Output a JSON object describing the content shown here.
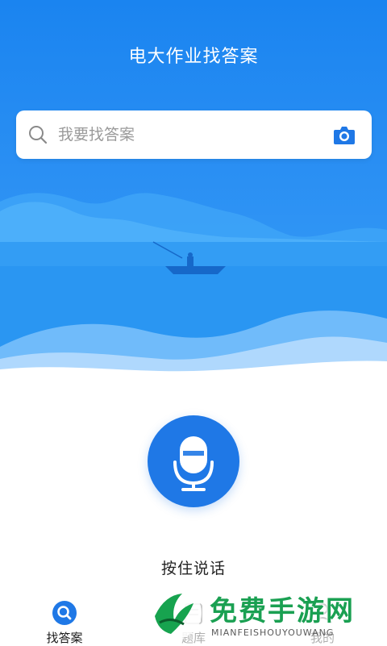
{
  "header": {
    "title": "电大作业找答案"
  },
  "search": {
    "placeholder": "我要找答案"
  },
  "voice": {
    "label": "按住说话"
  },
  "tabs": [
    {
      "label": "找答案",
      "active": true
    },
    {
      "label": "题库",
      "active": false
    },
    {
      "label": "我的",
      "active": false
    }
  ],
  "watermark": {
    "title": "免费手游网",
    "subtitle": "MIANFEISHOUYOUWANG"
  },
  "colors": {
    "primary": "#1f78e6",
    "header_top": "#1a84f0",
    "watermark_green": "#1aa052"
  },
  "icons": [
    "search-icon",
    "camera-icon",
    "microphone-icon",
    "search-tab-icon",
    "question-bank-icon",
    "profile-icon"
  ]
}
